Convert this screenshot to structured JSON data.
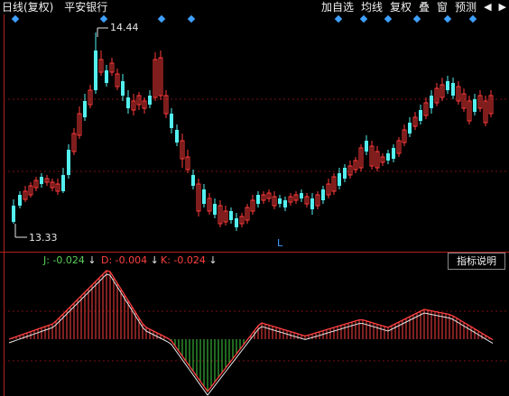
{
  "header": {
    "period_label": "日线(复权)",
    "stock_name": "平安银行",
    "toolbar": [
      "加自选",
      "均线",
      "复权",
      "叠",
      "窗",
      "预测"
    ],
    "nav_left": "◀",
    "nav_right": "▶"
  },
  "main_chart": {
    "high_label": "14.44",
    "low_label": "13.33",
    "low_marker": "L",
    "colors": {
      "up": "#ff3a3a",
      "down": "#54f0f0",
      "grid": "#8a1010",
      "text": "#e6e6e6",
      "marker": "#3ea0ff"
    }
  },
  "indicator": {
    "j_label": "J: -0.024",
    "d_label": "D: -0.004",
    "k_label": "K: -0.024",
    "j_color": "#5ad05a",
    "d_color": "#ff4040",
    "k_color": "#ff4040",
    "help_label": "指标说明"
  }
}
